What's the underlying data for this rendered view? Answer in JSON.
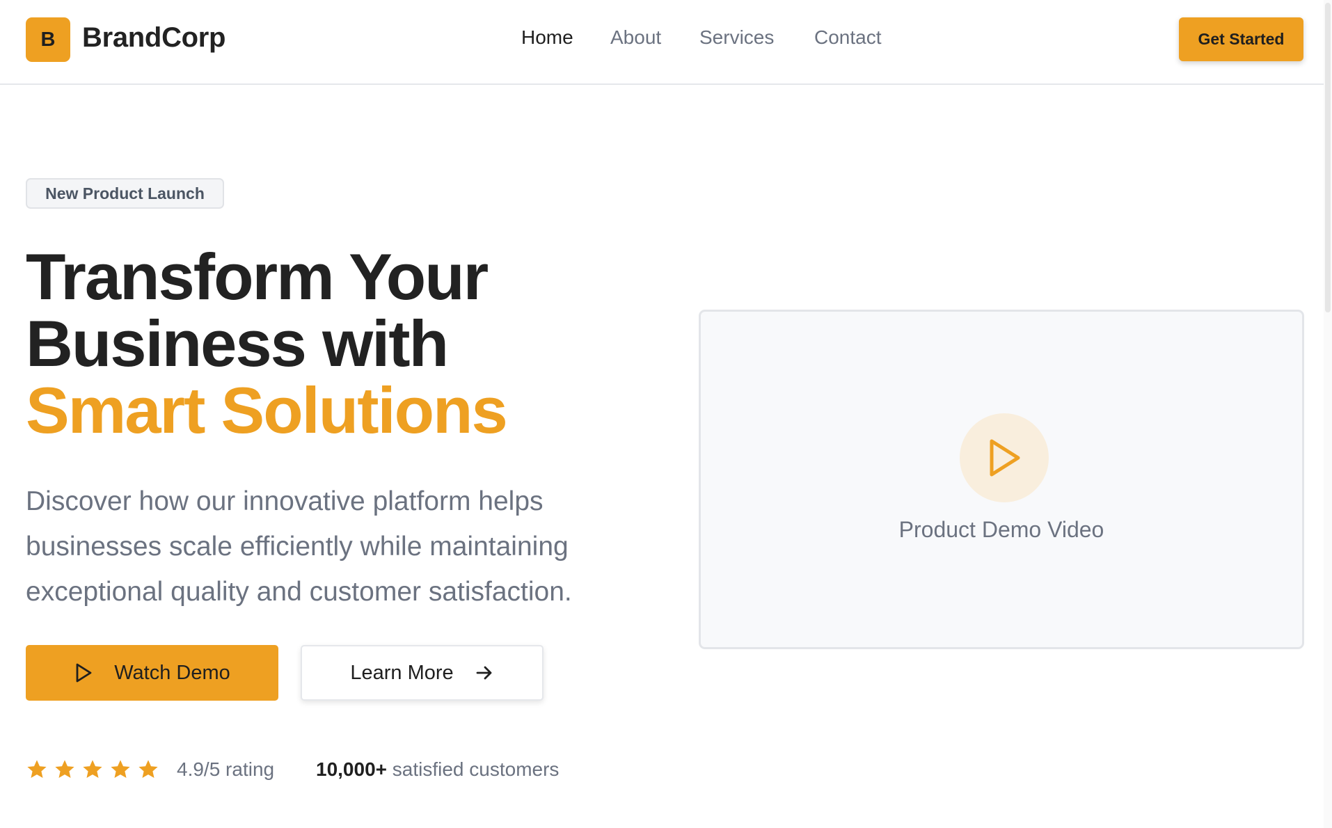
{
  "header": {
    "logo_letter": "B",
    "brand_name": "BrandCorp",
    "nav": [
      {
        "label": "Home",
        "active": true
      },
      {
        "label": "About",
        "active": false
      },
      {
        "label": "Services",
        "active": false
      },
      {
        "label": "Contact",
        "active": false
      }
    ],
    "cta_label": "Get Started"
  },
  "hero": {
    "badge": "New Product Launch",
    "headline_line1": "Transform Your",
    "headline_line2": "Business with",
    "headline_accent": "Smart Solutions",
    "description": "Discover how our innovative platform helps businesses scale efficiently while maintaining exceptional quality and customer satisfaction.",
    "primary_button": {
      "label": "Watch Demo",
      "icon": "play-icon"
    },
    "secondary_button": {
      "label": "Learn More",
      "icon": "arrow-right-icon"
    }
  },
  "social_proof": {
    "stars": 5,
    "rating_text": "4.9/5 rating",
    "customers_count": "10,000+",
    "customers_text": "satisfied customers"
  },
  "video": {
    "caption": "Product Demo Video",
    "icon": "play-icon"
  },
  "colors": {
    "accent": "#eea022",
    "text_dark": "#222222",
    "text_muted": "#6b7280",
    "play_circle_bg": "#f9eedd"
  }
}
